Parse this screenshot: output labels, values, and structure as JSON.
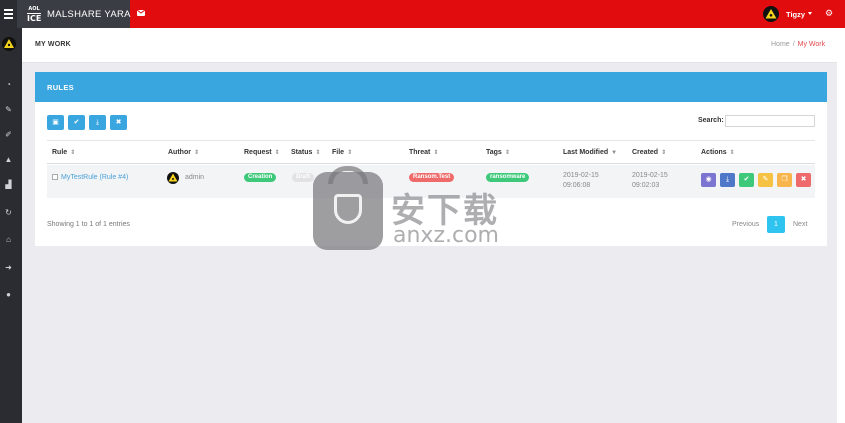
{
  "app": {
    "logo_top": "AOL",
    "logo_bottom": "ICE",
    "title": "MALSHARE YARA",
    "mail_icon": "envelope-icon",
    "user_name": "Tigzy",
    "settings_icon": "gear-icon",
    "accent": "#e10c0e"
  },
  "rail": {
    "items": [
      "dashboard-icon",
      "pencil-icon",
      "edit-icon",
      "flask-icon",
      "bar-chart-icon",
      "refresh-icon",
      "bank-icon",
      "arrow-right-icon",
      "globe-icon"
    ]
  },
  "page": {
    "title": "MY WORK",
    "breadcrumb_home": "Home",
    "breadcrumb_sep": "/",
    "breadcrumb_current": "My Work"
  },
  "card": {
    "title": "RULES",
    "toolbar": [
      "select-all-icon",
      "check-icon",
      "download-icon",
      "delete-icon"
    ],
    "search_label": "Search:",
    "search_value": ""
  },
  "table": {
    "headers": [
      "Rule",
      "Author",
      "Request",
      "Status",
      "File",
      "Threat",
      "Tags",
      "Last Modified",
      "Created",
      "Actions"
    ],
    "rows": [
      {
        "rule": "MyTestRule (Rule #4)",
        "author": "admin",
        "request": "Creation",
        "status": "Draft",
        "file": "",
        "threat": "Ransom.Test",
        "tags": "ransomware",
        "last_modified_date": "2019-02-15",
        "last_modified_time": "09:06:08",
        "created_date": "2019-02-15",
        "created_time": "09:02:03"
      }
    ]
  },
  "footer": {
    "showing": "Showing 1 to 1 of 1 entries",
    "previous": "Previous",
    "current_page": "1",
    "next": "Next"
  },
  "colors": {
    "header_blue": "#3aa6e0",
    "creation_green": "#3ec97a",
    "threat_red": "#ef6a6a",
    "tag_green": "#3ec97a",
    "action_view": "#7b74d0",
    "action_download": "#4f78c9",
    "action_approve": "#3ec97a",
    "action_edit": "#f6c244",
    "action_copy": "#f7b54c",
    "action_delete": "#ef6a6a"
  },
  "watermark": {
    "cn": "安下载",
    "en": "anxz.com"
  }
}
